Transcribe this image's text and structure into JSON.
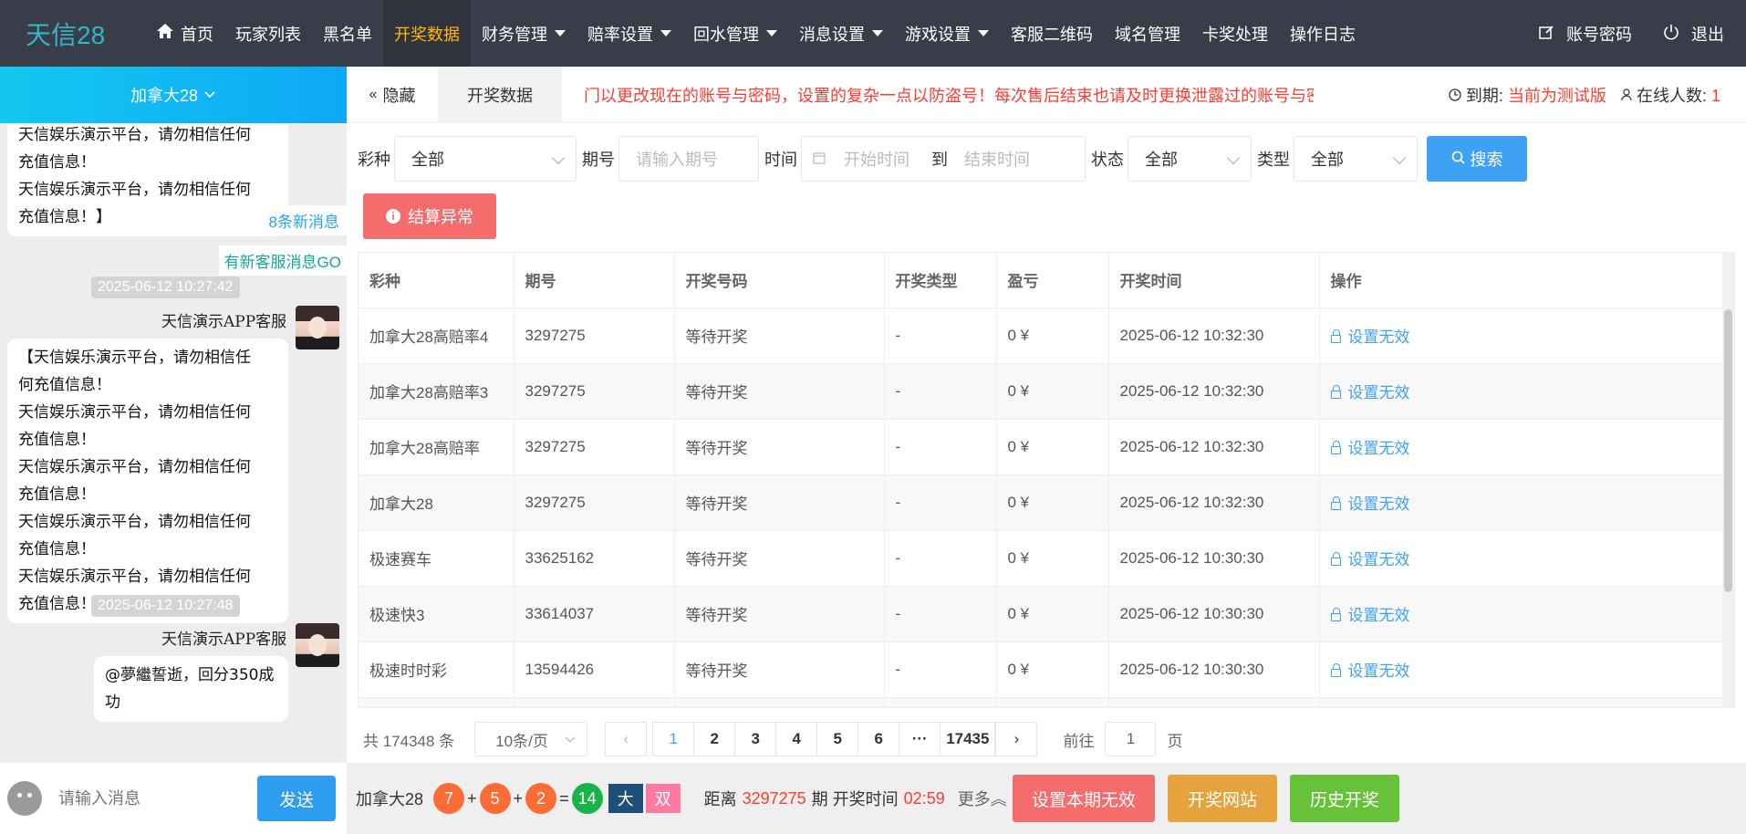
{
  "app": {
    "logo_text": "天信",
    "logo_num": "28"
  },
  "nav": {
    "items": [
      {
        "label": "首页",
        "icon": "home-icon"
      },
      {
        "label": "玩家列表"
      },
      {
        "label": "黑名单"
      },
      {
        "label": "开奖数据",
        "active": true
      },
      {
        "label": "财务管理",
        "dropdown": true
      },
      {
        "label": "赔率设置",
        "dropdown": true
      },
      {
        "label": "回水管理",
        "dropdown": true
      },
      {
        "label": "消息设置",
        "dropdown": true
      },
      {
        "label": "游戏设置",
        "dropdown": true
      },
      {
        "label": "客服二维码"
      },
      {
        "label": "域名管理"
      },
      {
        "label": "卡奖处理"
      },
      {
        "label": "操作日志"
      }
    ],
    "account": "账号密码",
    "logout": "退出"
  },
  "left": {
    "header": "加拿大28",
    "tag_new": "8条新消息",
    "tag_service": "有新客服消息GO",
    "msg1": [
      "天信娱乐演示平台，请勿相信任何",
      "充值信息！",
      "天信娱乐演示平台，请勿相信任何",
      "充值信息！】"
    ],
    "ts1": "2025-06-12 10:27:42",
    "sender1": "天信演示APP客服",
    "msg2": [
      "【天信娱乐演示平台，请勿相信任",
      "何充值信息！",
      "天信娱乐演示平台，请勿相信任何",
      "充值信息！",
      "天信娱乐演示平台，请勿相信任何",
      "充值信息！",
      "天信娱乐演示平台，请勿相信任何",
      "充值信息！",
      "天信娱乐演示平台，请勿相信任何",
      "充值信息！】"
    ],
    "ts2": "2025-06-12 10:27:48",
    "sender2": "天信演示APP客服",
    "msg3": "@夢繼誓逝，回分350成功",
    "input_placeholder": "请输入消息",
    "send": "发送"
  },
  "tabbar": {
    "hide": "隐藏",
    "tab": "开奖数据",
    "notice": "门以更改现在的账号与密码，设置的复杂一点以防盗号！每次售后结束也请及时更换泄露过的账号与密码！",
    "expire_label": "到期:",
    "expire_value": "当前为测试版",
    "online_label": "在线人数:",
    "online_value": "1"
  },
  "filters": {
    "lottery_label": "彩种",
    "lottery_value": "全部",
    "period_label": "期号",
    "period_placeholder": "请输入期号",
    "time_label": "时间",
    "start_placeholder": "开始时间",
    "to": "到",
    "end_placeholder": "结束时间",
    "status_label": "状态",
    "status_value": "全部",
    "type_label": "类型",
    "type_value": "全部",
    "search": "搜索",
    "abnormal": "结算异常"
  },
  "table": {
    "columns": [
      "彩种",
      "期号",
      "开奖号码",
      "开奖类型",
      "盈亏",
      "开奖时间",
      "操作"
    ],
    "rows": [
      [
        "加拿大28高赔率4",
        "3297275",
        "等待开奖",
        "-",
        "0 ¥",
        "2025-06-12 10:32:30",
        "设置无效"
      ],
      [
        "加拿大28高赔率3",
        "3297275",
        "等待开奖",
        "-",
        "0 ¥",
        "2025-06-12 10:32:30",
        "设置无效"
      ],
      [
        "加拿大28高赔率",
        "3297275",
        "等待开奖",
        "-",
        "0 ¥",
        "2025-06-12 10:32:30",
        "设置无效"
      ],
      [
        "加拿大28",
        "3297275",
        "等待开奖",
        "-",
        "0 ¥",
        "2025-06-12 10:32:30",
        "设置无效"
      ],
      [
        "极速赛车",
        "33625162",
        "等待开奖",
        "-",
        "0 ¥",
        "2025-06-12 10:30:30",
        "设置无效"
      ],
      [
        "极速快3",
        "33614037",
        "等待开奖",
        "-",
        "0 ¥",
        "2025-06-12 10:30:30",
        "设置无效"
      ],
      [
        "极速时时彩",
        "13594426",
        "等待开奖",
        "-",
        "0 ¥",
        "2025-06-12 10:30:30",
        "设置无效"
      ]
    ]
  },
  "pager": {
    "total": "共 174348 条",
    "size": "10条/页",
    "pages": [
      "1",
      "2",
      "3",
      "4",
      "5",
      "6",
      "···",
      "17435"
    ],
    "goto_label": "前往",
    "goto_value": "1",
    "page_suffix": "页"
  },
  "bottom": {
    "game": "加拿大28",
    "n1": "7",
    "n2": "5",
    "n3": "2",
    "sum": "14",
    "plus": "+",
    "eq": "=",
    "big": "大",
    "even": "双",
    "distance": "距离",
    "period": "3297275",
    "period_suffix": "期 开奖时间",
    "countdown": "02:59",
    "more": "更多",
    "btn_invalid": "设置本期无效",
    "btn_site": "开奖网站",
    "btn_history": "历史开奖"
  }
}
